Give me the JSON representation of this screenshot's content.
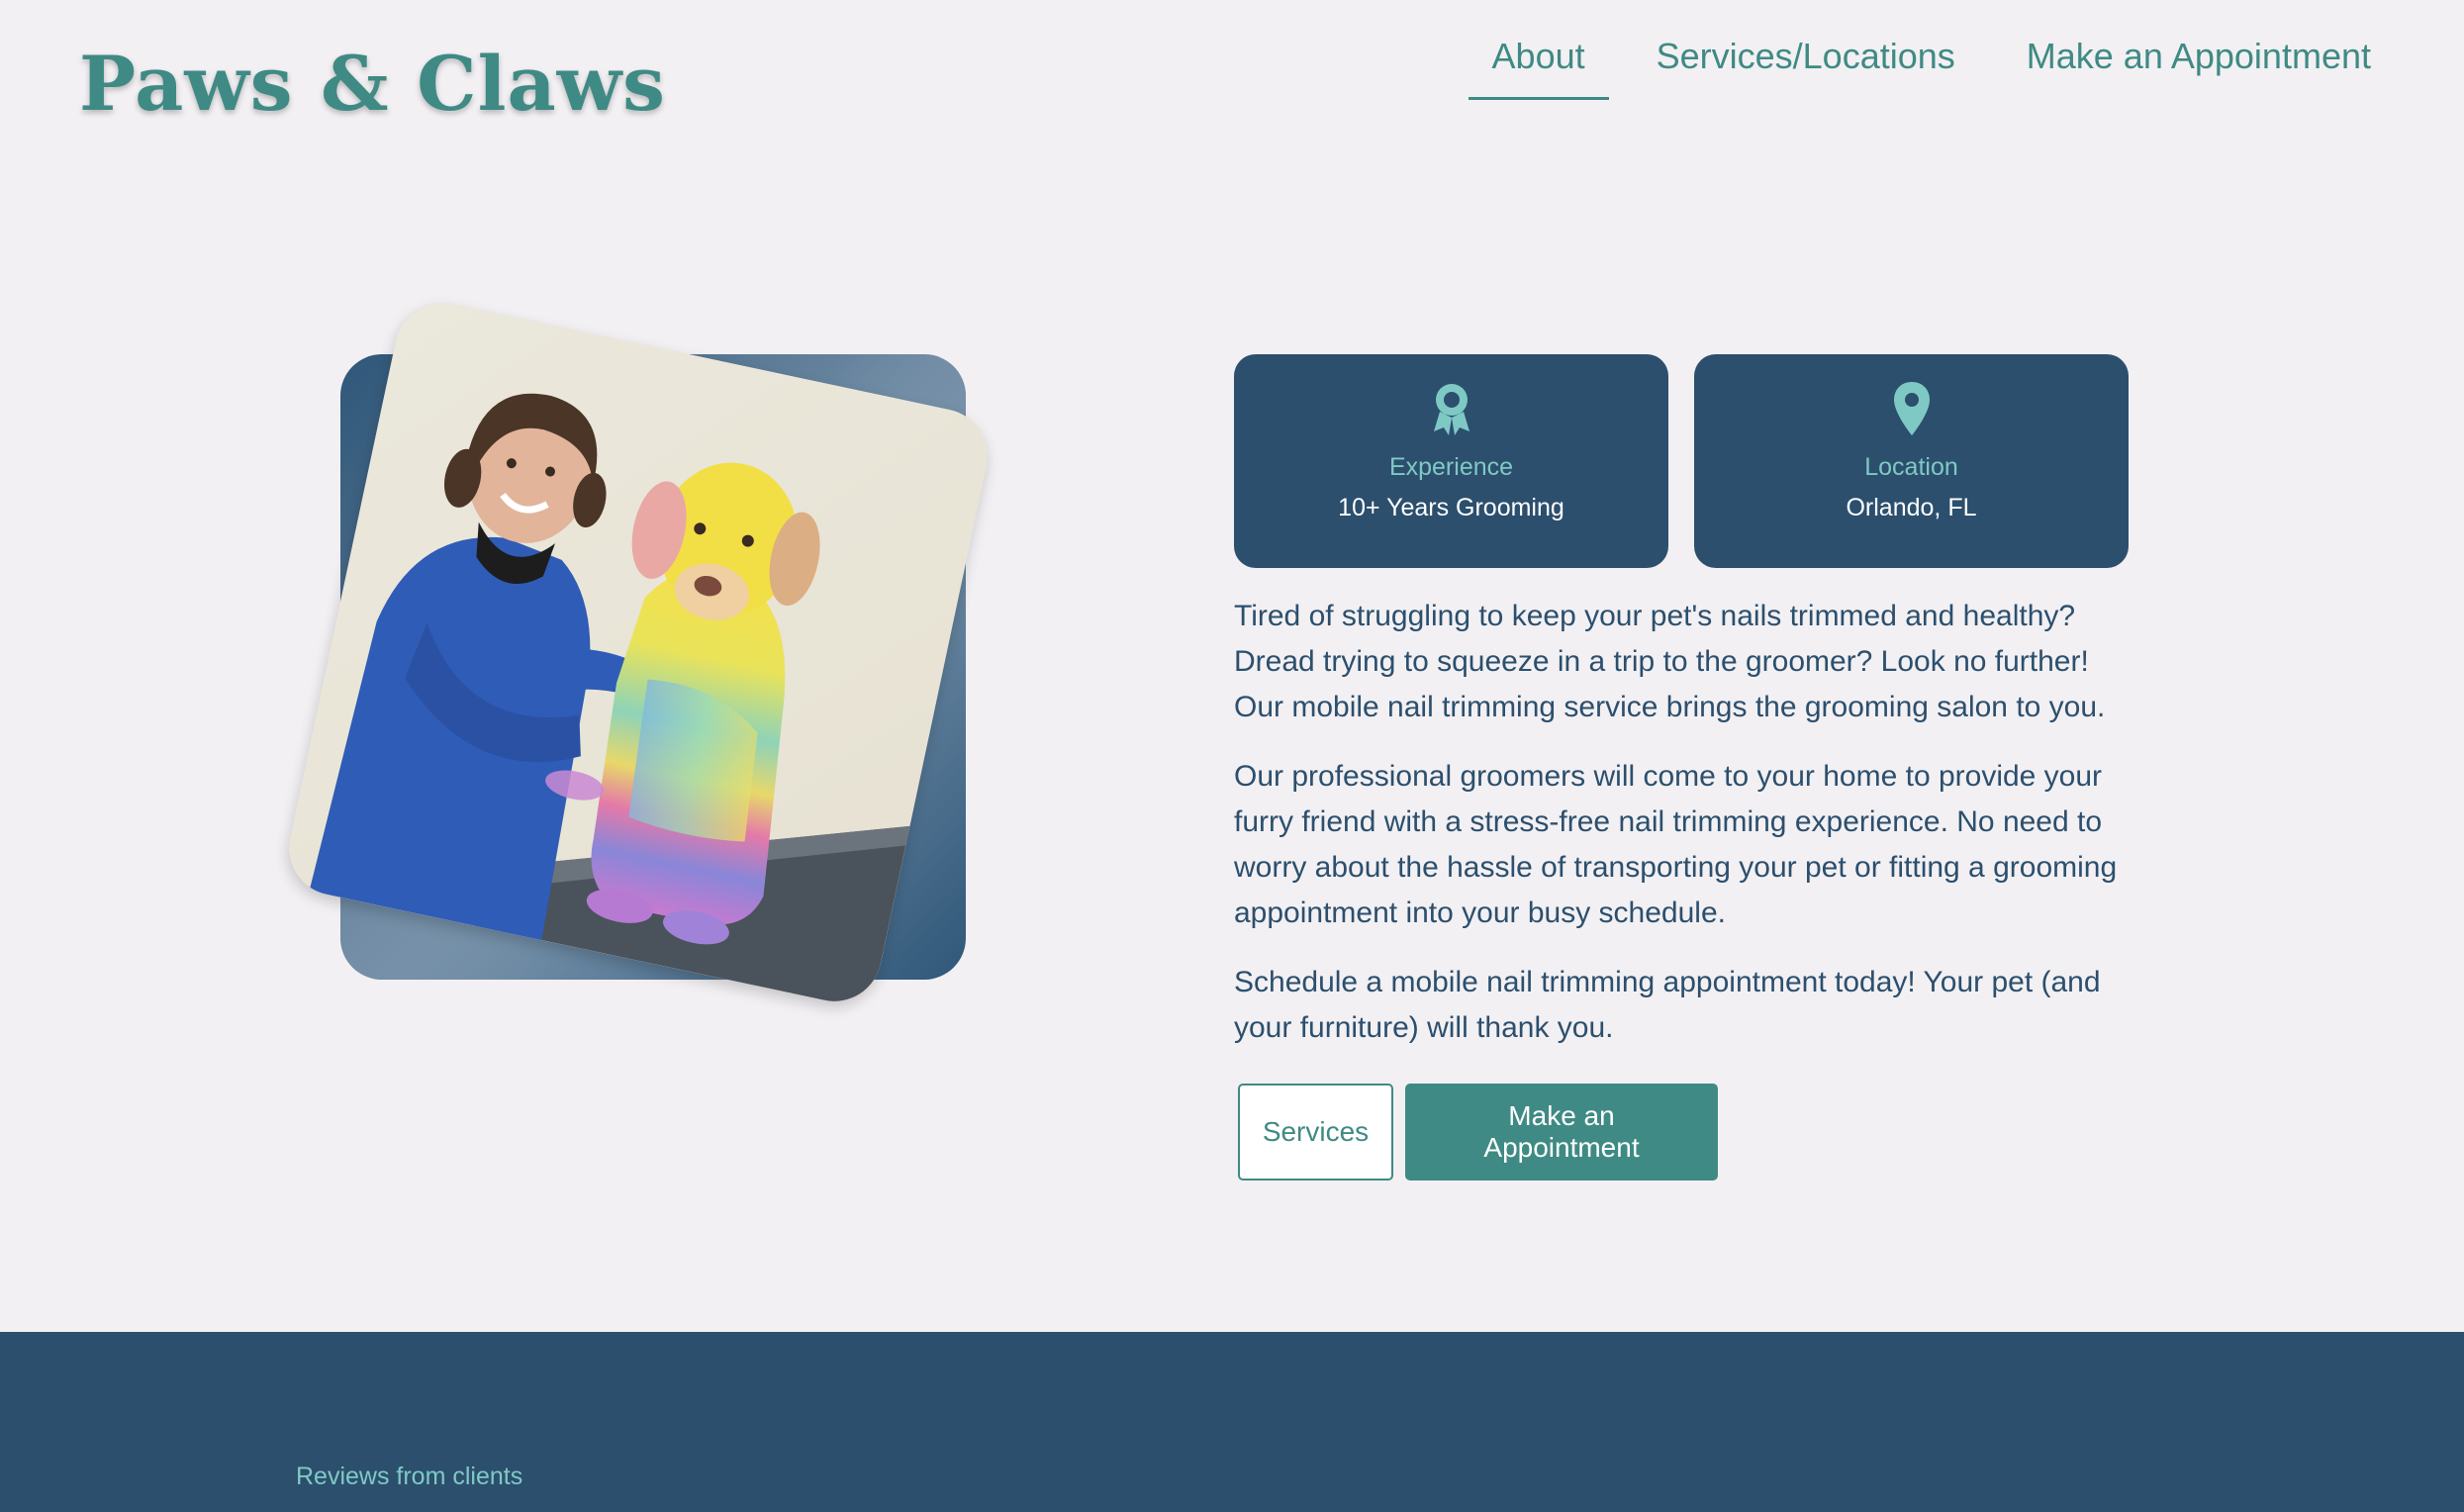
{
  "brand": {
    "logo": "Paws & Claws"
  },
  "nav": {
    "items": [
      {
        "label": "About",
        "active": true
      },
      {
        "label": "Services/Locations",
        "active": false
      },
      {
        "label": "Make an Appointment",
        "active": false
      }
    ]
  },
  "hero": {
    "photo_icon": "groomer-with-rainbow-dog-photo",
    "cards": [
      {
        "icon": "award-icon",
        "title": "Experience",
        "value": "10+ Years Grooming"
      },
      {
        "icon": "location-pin-icon",
        "title": "Location",
        "value": "Orlando, FL"
      }
    ],
    "paragraphs": [
      "Tired of struggling to keep your pet's nails trimmed and healthy? Dread trying to squeeze in a trip to the groomer? Look no further! Our mobile nail trimming service brings the grooming salon to you.",
      "Our professional groomers will come to your home to provide your furry friend with a stress-free nail trimming experience. No need to worry about the hassle of transporting your pet or fitting a grooming appointment into your busy schedule.",
      "Schedule a mobile nail trimming appointment today! Your pet (and your furniture) will thank you."
    ],
    "buttons": {
      "services": "Services",
      "appointment": "Make an Appointment"
    }
  },
  "footer": {
    "reviews_label": "Reviews from clients"
  },
  "colors": {
    "accent": "#3f8a84",
    "navy": "#2c4f6d",
    "card_title": "#7fc9c5",
    "background": "#f2f0f3"
  }
}
